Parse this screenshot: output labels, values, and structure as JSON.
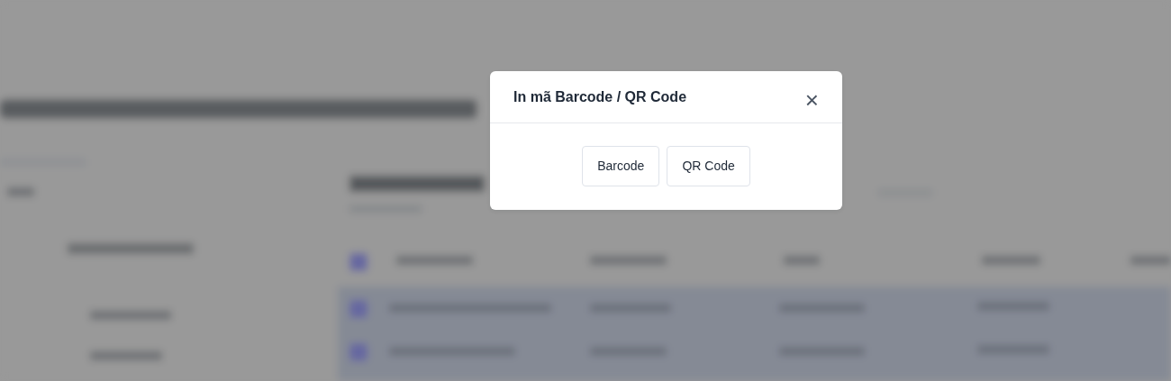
{
  "modal": {
    "title": "In mã Barcode / QR Code",
    "close": "×",
    "buttons": [
      {
        "label": "Barcode"
      },
      {
        "label": "QR Code"
      }
    ]
  }
}
